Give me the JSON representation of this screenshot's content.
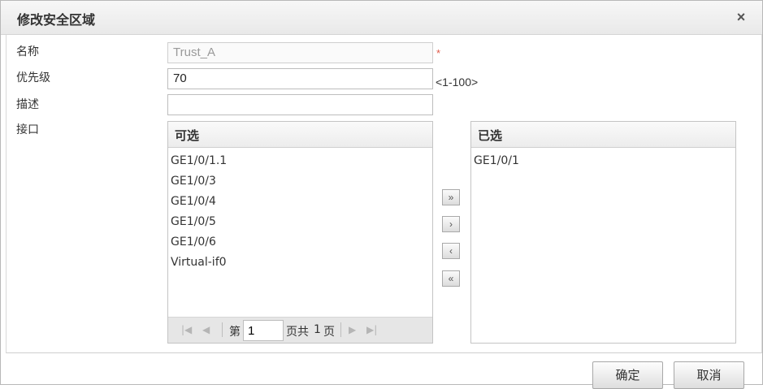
{
  "dialog": {
    "title": "修改安全区域",
    "close_icon": "×"
  },
  "form": {
    "name_label": "名称",
    "name_value": "Trust_A",
    "required_mark": "*",
    "priority_label": "优先级",
    "priority_value": "70",
    "priority_hint": "<1-100>",
    "desc_label": "描述",
    "desc_value": "",
    "interface_label": "接口"
  },
  "available": {
    "header": "可选",
    "items": [
      "GE1/0/1.1",
      "GE1/0/3",
      "GE1/0/4",
      "GE1/0/5",
      "GE1/0/6",
      "Virtual-if0"
    ]
  },
  "selected": {
    "header": "已选",
    "items": [
      "GE1/0/1"
    ]
  },
  "pager": {
    "page_prefix": "第",
    "page_value": "1",
    "page_suffix": "页共",
    "total_pages": "1",
    "page_unit": "页"
  },
  "move_buttons": {
    "add_all": "»",
    "add": "›",
    "remove": "‹",
    "remove_all": "«"
  },
  "footer": {
    "ok": "确定",
    "cancel": "取消"
  }
}
